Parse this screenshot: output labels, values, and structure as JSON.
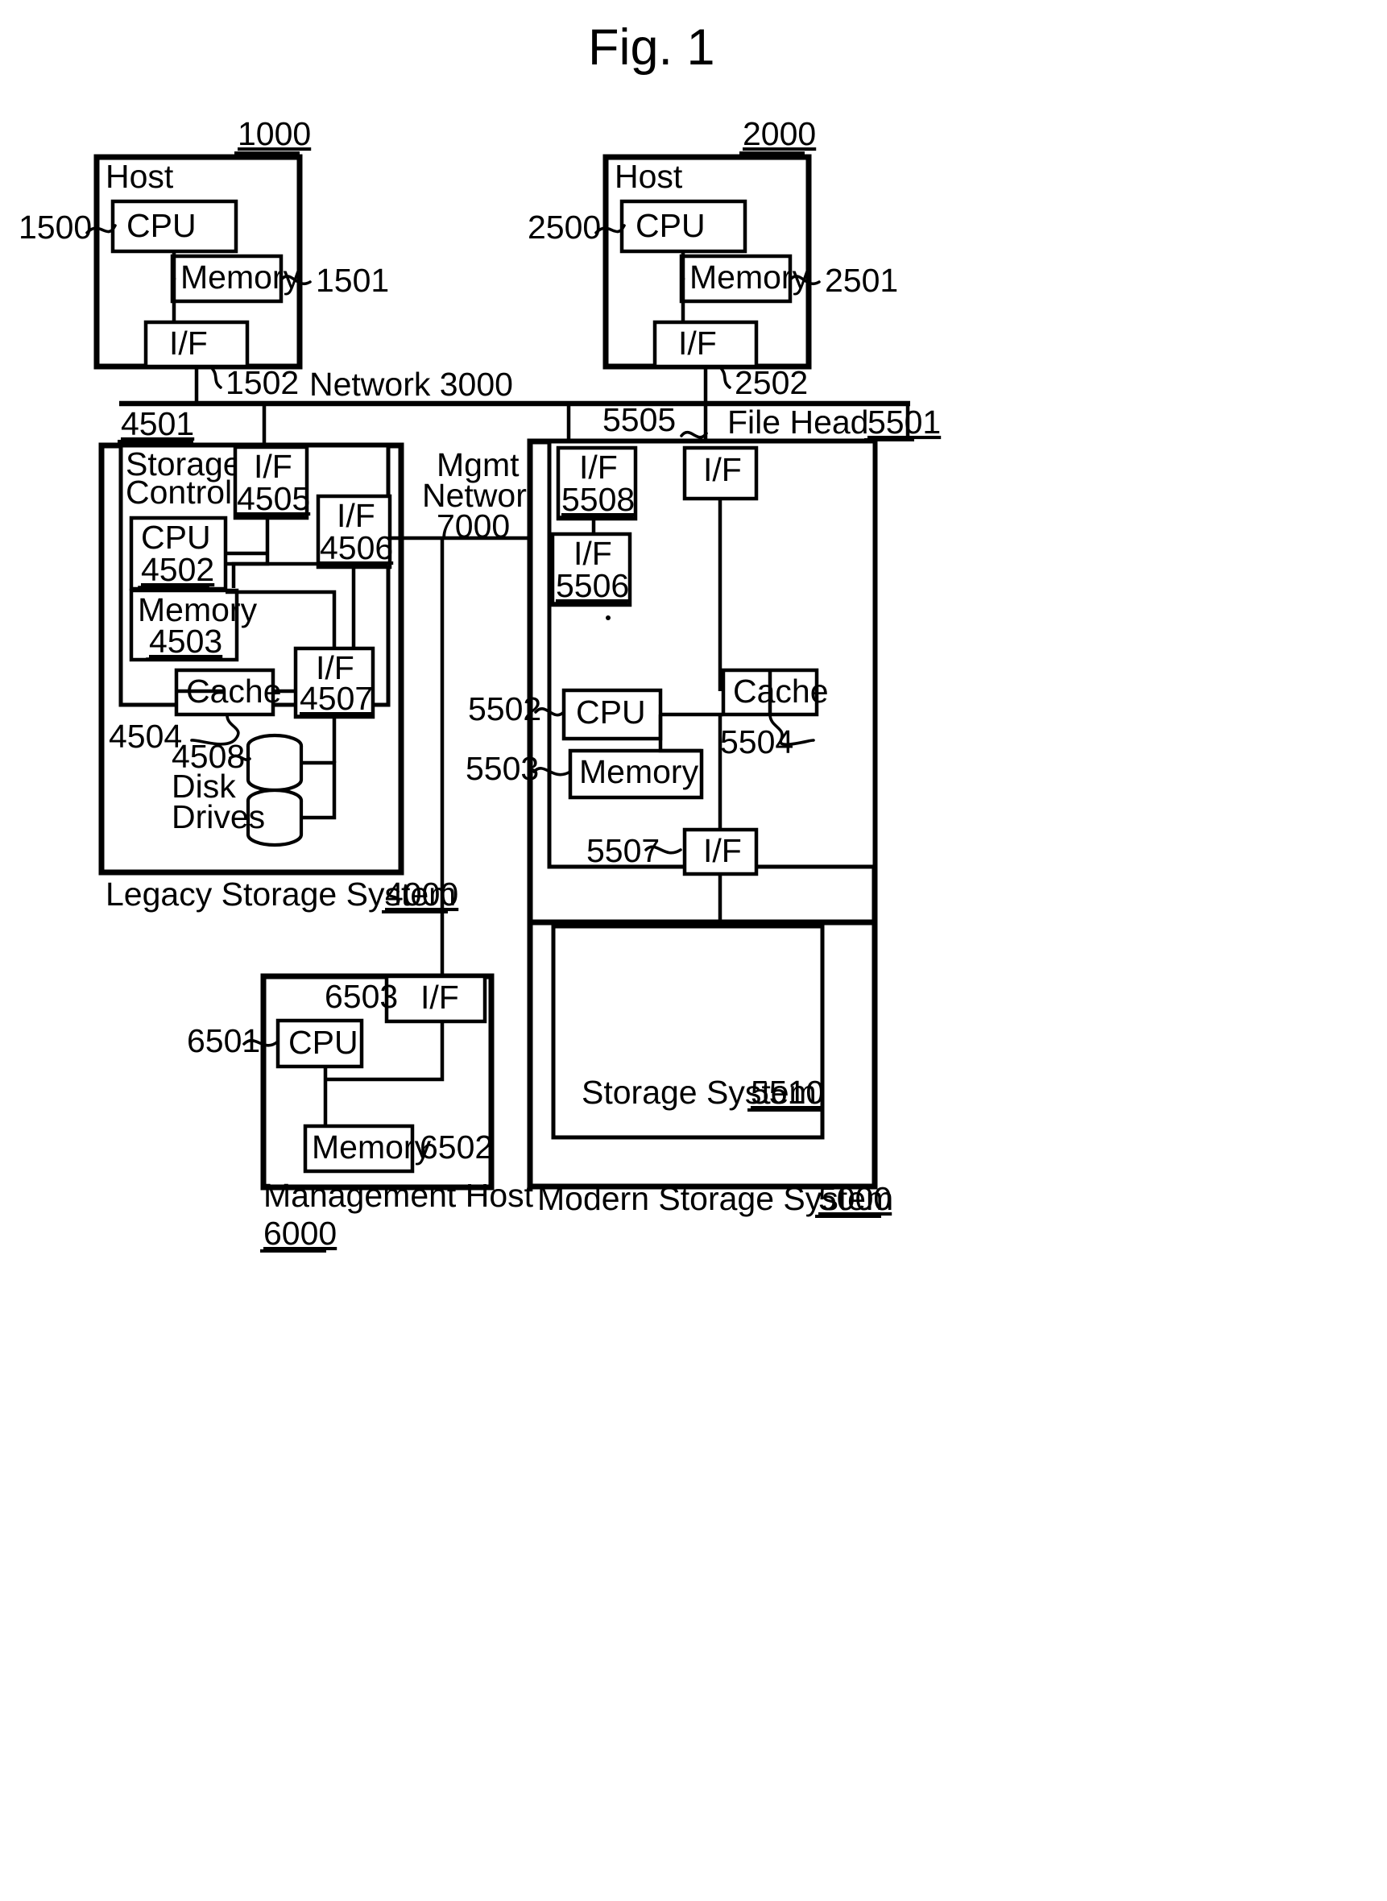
{
  "figure": {
    "title": "Fig. 1"
  },
  "host1": {
    "ref": "1000",
    "title": "Host",
    "cpu": {
      "label": "CPU",
      "ref": "1500"
    },
    "memory": {
      "label": "Memory",
      "ref": "1501"
    },
    "interface": {
      "label": "I/F",
      "ref": "1502"
    }
  },
  "host2": {
    "ref": "2000",
    "title": "Host",
    "cpu": {
      "label": "CPU",
      "ref": "2500"
    },
    "memory": {
      "label": "Memory",
      "ref": "2501"
    },
    "interface": {
      "label": "I/F",
      "ref": "2502"
    }
  },
  "network": {
    "label": "Network 3000"
  },
  "mgmt_network": {
    "line1": "Mgmt",
    "line2": "Network",
    "line3": "7000"
  },
  "legacy": {
    "caption": "Legacy Storage System",
    "ref": "4000",
    "controller": {
      "ref": "4501",
      "line1": "Storage",
      "line2": "Controller"
    },
    "cpu": {
      "label": "CPU",
      "ref": "4502"
    },
    "memory": {
      "label": "Memory",
      "ref": "4503"
    },
    "cache": {
      "label": "Cache",
      "ref": "4504"
    },
    "if_top": {
      "label": "I/F",
      "ref": "4505"
    },
    "if_mgmt": {
      "label": "I/F",
      "ref": "4506"
    },
    "if_disk": {
      "label": "I/F",
      "ref": "4507"
    },
    "disks": {
      "ref": "4508",
      "line1": "Disk",
      "line2": "Drives"
    }
  },
  "modern": {
    "caption": "Modern Storage System",
    "ref": "5000",
    "filehead": {
      "caption": "File Head",
      "ref": "5501"
    },
    "if_net": {
      "label": "I/F",
      "ref": "5508"
    },
    "if_host": {
      "label": "I/F",
      "ref": "5505"
    },
    "if_mgmt": {
      "label": "I/F",
      "ref": "5506"
    },
    "if_storage": {
      "label": "I/F",
      "ref": "5507"
    },
    "cpu": {
      "label": "CPU",
      "ref": "5502"
    },
    "memory": {
      "label": "Memory",
      "ref": "5503"
    },
    "cache": {
      "label": "Cache",
      "ref": "5504"
    },
    "storage_system": {
      "caption": "Storage System",
      "ref": "5510"
    }
  },
  "mgmt_host": {
    "caption": "Management Host",
    "ref": "6000",
    "cpu": {
      "label": "CPU",
      "ref": "6501"
    },
    "memory": {
      "label": "Memory",
      "ref": "6502"
    },
    "interface": {
      "label": "I/F",
      "ref": "6503"
    }
  }
}
